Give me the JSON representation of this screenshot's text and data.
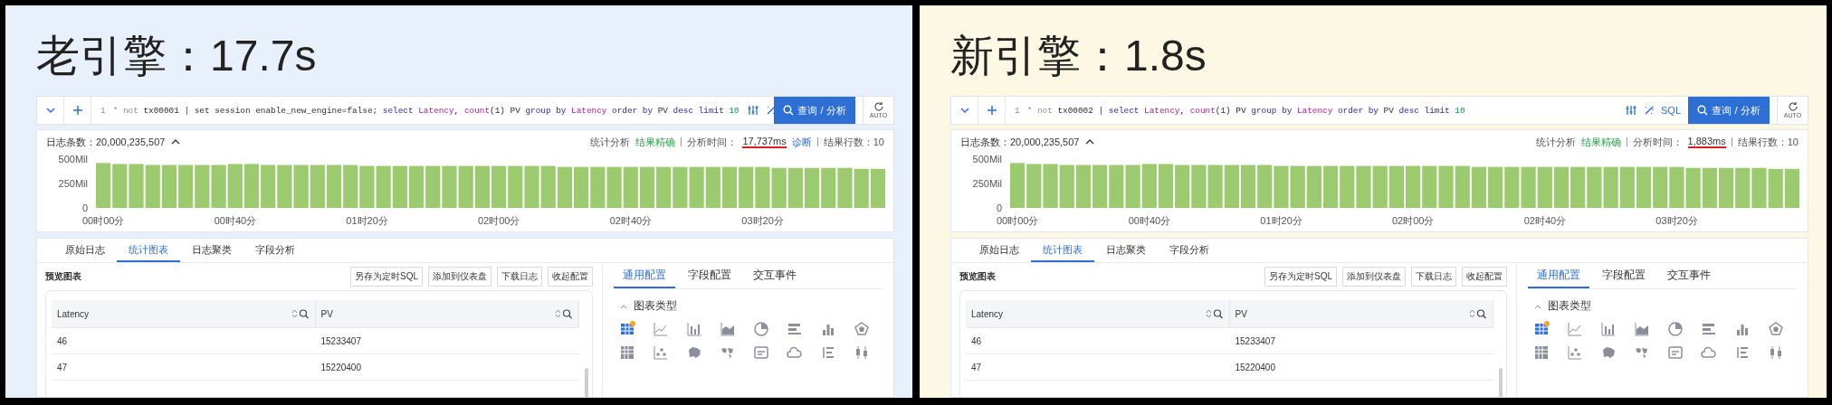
{
  "panels": [
    {
      "color": "#e8f0fb",
      "title": "老引擎：17.7s",
      "query": {
        "line_number": "1",
        "tokens": [
          {
            "text": "* not ",
            "kind": "dim"
          },
          {
            "text": "tx00001 | set session enable_new_engine=false; ",
            "kind": "plain"
          },
          {
            "text": "select ",
            "kind": "keyword"
          },
          {
            "text": "Latency",
            "kind": "field"
          },
          {
            "text": ", ",
            "kind": "plain"
          },
          {
            "text": "count",
            "kind": "field"
          },
          {
            "text": "(1) PV ",
            "kind": "plain"
          },
          {
            "text": "group by ",
            "kind": "keyword"
          },
          {
            "text": "Latency ",
            "kind": "field"
          },
          {
            "text": "order by ",
            "kind": "keyword"
          },
          {
            "text": "PV ",
            "kind": "plain"
          },
          {
            "text": "desc limit ",
            "kind": "keyword"
          },
          {
            "text": "10",
            "kind": "number"
          }
        ]
      },
      "run_button": "查询 / 分析",
      "auto_label": "AUTO",
      "stats": {
        "count_label": "日志条数：",
        "count": "20,000,235,507",
        "mode": "统计分析",
        "accuracy": "结果精确",
        "time_label": "分析时间：",
        "time": "17,737ms",
        "diagnose": "诊断",
        "rows_label": "结果行数：",
        "rows": "10"
      },
      "chart_data": {
        "type": "bar",
        "categories": [
          "00时00分",
          null,
          null,
          null,
          null,
          null,
          null,
          null,
          "00时40分",
          null,
          null,
          null,
          null,
          null,
          null,
          null,
          "01时20分",
          null,
          null,
          null,
          null,
          null,
          null,
          null,
          "02时00分",
          null,
          null,
          null,
          null,
          null,
          null,
          null,
          "02时40分",
          null,
          null,
          null,
          null,
          null,
          null,
          null,
          "03时20分",
          null,
          null,
          null,
          null,
          null,
          null,
          null
        ],
        "values": [
          460,
          450,
          450,
          440,
          440,
          440,
          440,
          440,
          450,
          450,
          440,
          440,
          440,
          440,
          440,
          440,
          430,
          430,
          430,
          430,
          430,
          430,
          430,
          430,
          430,
          430,
          430,
          430,
          420,
          420,
          420,
          420,
          420,
          420,
          420,
          420,
          420,
          420,
          420,
          420,
          420,
          410,
          410,
          410,
          410,
          410,
          400,
          400
        ],
        "ylim": [
          0,
          500
        ],
        "yticks": [
          {
            "value": 0,
            "label": "0"
          },
          {
            "value": 250,
            "label": "250Mil"
          },
          {
            "value": 500,
            "label": "500Mil"
          }
        ]
      },
      "tabs": [
        {
          "label": "原始日志",
          "selected": false
        },
        {
          "label": "统计图表",
          "selected": true
        },
        {
          "label": "日志聚类",
          "selected": false
        },
        {
          "label": "字段分析",
          "selected": false
        }
      ],
      "preview_title": "预览图表",
      "actions": [
        "另存为定时SQL",
        "添加到仪表盘",
        "下载日志",
        "收起配置"
      ],
      "table": {
        "columns": [
          "Latency",
          "PV"
        ],
        "rows": [
          [
            "46",
            "15233407"
          ],
          [
            "47",
            "15220400"
          ]
        ]
      },
      "config_tabs": [
        {
          "label": "通用配置",
          "selected": true
        },
        {
          "label": "字段配置",
          "selected": false
        },
        {
          "label": "交互事件",
          "selected": false
        }
      ],
      "section": "图表类型",
      "chart_types": [
        {
          "kind": "table",
          "selected": true
        },
        {
          "kind": "line",
          "selected": false
        },
        {
          "kind": "bar",
          "selected": false
        },
        {
          "kind": "area",
          "selected": false
        },
        {
          "kind": "pie",
          "selected": false
        },
        {
          "kind": "bars",
          "selected": false
        },
        {
          "kind": "column",
          "selected": false
        },
        {
          "kind": "radar",
          "selected": false
        },
        {
          "kind": "grid",
          "selected": false
        },
        {
          "kind": "scatter",
          "selected": false
        },
        {
          "kind": "map",
          "selected": false
        },
        {
          "kind": "world",
          "selected": false
        },
        {
          "kind": "card",
          "selected": false
        },
        {
          "kind": "cloud",
          "selected": false
        },
        {
          "kind": "list",
          "selected": false
        },
        {
          "kind": "box",
          "selected": false
        }
      ]
    },
    {
      "color": "#fdf8e3",
      "title": "新引擎：1.8s",
      "query": {
        "line_number": "1",
        "tokens": [
          {
            "text": "* not ",
            "kind": "dim"
          },
          {
            "text": "tx00002 | ",
            "kind": "plain"
          },
          {
            "text": "select ",
            "kind": "keyword"
          },
          {
            "text": "Latency",
            "kind": "field"
          },
          {
            "text": ", ",
            "kind": "plain"
          },
          {
            "text": "count",
            "kind": "field"
          },
          {
            "text": "(1) PV ",
            "kind": "plain"
          },
          {
            "text": "group by ",
            "kind": "keyword"
          },
          {
            "text": "Latency ",
            "kind": "field"
          },
          {
            "text": "order by ",
            "kind": "keyword"
          },
          {
            "text": "PV ",
            "kind": "plain"
          },
          {
            "text": "desc limit ",
            "kind": "keyword"
          },
          {
            "text": "10",
            "kind": "number"
          }
        ]
      },
      "sql_label": "SQL",
      "run_button": "查询 / 分析",
      "auto_label": "AUTO",
      "stats": {
        "count_label": "日志条数：",
        "count": "20,000,235,507",
        "mode": "统计分析",
        "accuracy": "结果精确",
        "time_label": "分析时间：",
        "time": "1,883ms",
        "rows_label": "结果行数：",
        "rows": "10"
      },
      "chart_data": {
        "type": "bar",
        "categories": [
          "00时00分",
          null,
          null,
          null,
          null,
          null,
          null,
          null,
          "00时40分",
          null,
          null,
          null,
          null,
          null,
          null,
          null,
          "01时20分",
          null,
          null,
          null,
          null,
          null,
          null,
          null,
          "02时00分",
          null,
          null,
          null,
          null,
          null,
          null,
          null,
          "02时40分",
          null,
          null,
          null,
          null,
          null,
          null,
          null,
          "03时20分",
          null,
          null,
          null,
          null,
          null,
          null,
          null
        ],
        "values": [
          460,
          450,
          450,
          440,
          440,
          440,
          440,
          440,
          450,
          450,
          440,
          440,
          440,
          440,
          440,
          440,
          430,
          430,
          430,
          430,
          430,
          430,
          430,
          430,
          430,
          430,
          430,
          430,
          420,
          420,
          420,
          420,
          420,
          420,
          420,
          420,
          420,
          420,
          420,
          420,
          420,
          410,
          410,
          410,
          410,
          410,
          400,
          400
        ],
        "ylim": [
          0,
          500
        ],
        "yticks": [
          {
            "value": 0,
            "label": "0"
          },
          {
            "value": 250,
            "label": "250Mil"
          },
          {
            "value": 500,
            "label": "500Mil"
          }
        ]
      },
      "tabs": [
        {
          "label": "原始日志",
          "selected": false
        },
        {
          "label": "统计图表",
          "selected": true
        },
        {
          "label": "日志聚类",
          "selected": false
        },
        {
          "label": "字段分析",
          "selected": false
        }
      ],
      "preview_title": "预览图表",
      "actions": [
        "另存为定时SQL",
        "添加到仪表盘",
        "下载日志",
        "收起配置"
      ],
      "table": {
        "columns": [
          "Latency",
          "PV"
        ],
        "rows": [
          [
            "46",
            "15233407"
          ],
          [
            "47",
            "15220400"
          ]
        ]
      },
      "config_tabs": [
        {
          "label": "通用配置",
          "selected": true
        },
        {
          "label": "字段配置",
          "selected": false
        },
        {
          "label": "交互事件",
          "selected": false
        }
      ],
      "section": "图表类型",
      "chart_types": [
        {
          "kind": "table",
          "selected": true
        },
        {
          "kind": "line",
          "selected": false
        },
        {
          "kind": "bar",
          "selected": false
        },
        {
          "kind": "area",
          "selected": false
        },
        {
          "kind": "pie",
          "selected": false
        },
        {
          "kind": "bars",
          "selected": false
        },
        {
          "kind": "column",
          "selected": false
        },
        {
          "kind": "radar",
          "selected": false
        },
        {
          "kind": "grid",
          "selected": false
        },
        {
          "kind": "scatter",
          "selected": false
        },
        {
          "kind": "map",
          "selected": false
        },
        {
          "kind": "world",
          "selected": false
        },
        {
          "kind": "card",
          "selected": false
        },
        {
          "kind": "cloud",
          "selected": false
        },
        {
          "kind": "list",
          "selected": false
        },
        {
          "kind": "box",
          "selected": false
        }
      ]
    }
  ]
}
